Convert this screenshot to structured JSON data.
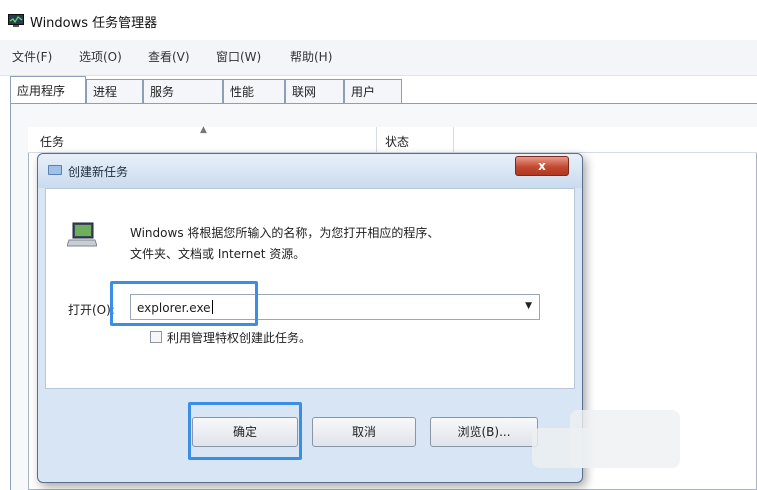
{
  "window": {
    "title": "Windows 任务管理器",
    "app_icon": "task-manager-monitor-icon"
  },
  "menu": [
    "文件(F)",
    "选项(O)",
    "查看(V)",
    "窗口(W)",
    "帮助(H)"
  ],
  "tabs": [
    "应用程序",
    "进程",
    "服务",
    "性能",
    "联网",
    "用户"
  ],
  "active_tab": "应用程序",
  "columns": {
    "task": "任务",
    "status": "状态"
  },
  "dialog": {
    "title": "创建新任务",
    "close_label": "x",
    "description_line1": "Windows 将根据您所输入的名称，为您打开相应的程序、",
    "description_line2": "文件夹、文档或 Internet 资源。",
    "open_label": "打开(O):",
    "open_value": "explorer.exe",
    "checkbox_label": "利用管理特权创建此任务。",
    "checkbox_checked": false,
    "ok_label": "确定",
    "cancel_label": "取消",
    "browse_label": "浏览(B)..."
  },
  "colors": {
    "highlight": "#3a8ee6",
    "close_button": "#c24a32",
    "dialog_frame": "#d8e5f4"
  }
}
